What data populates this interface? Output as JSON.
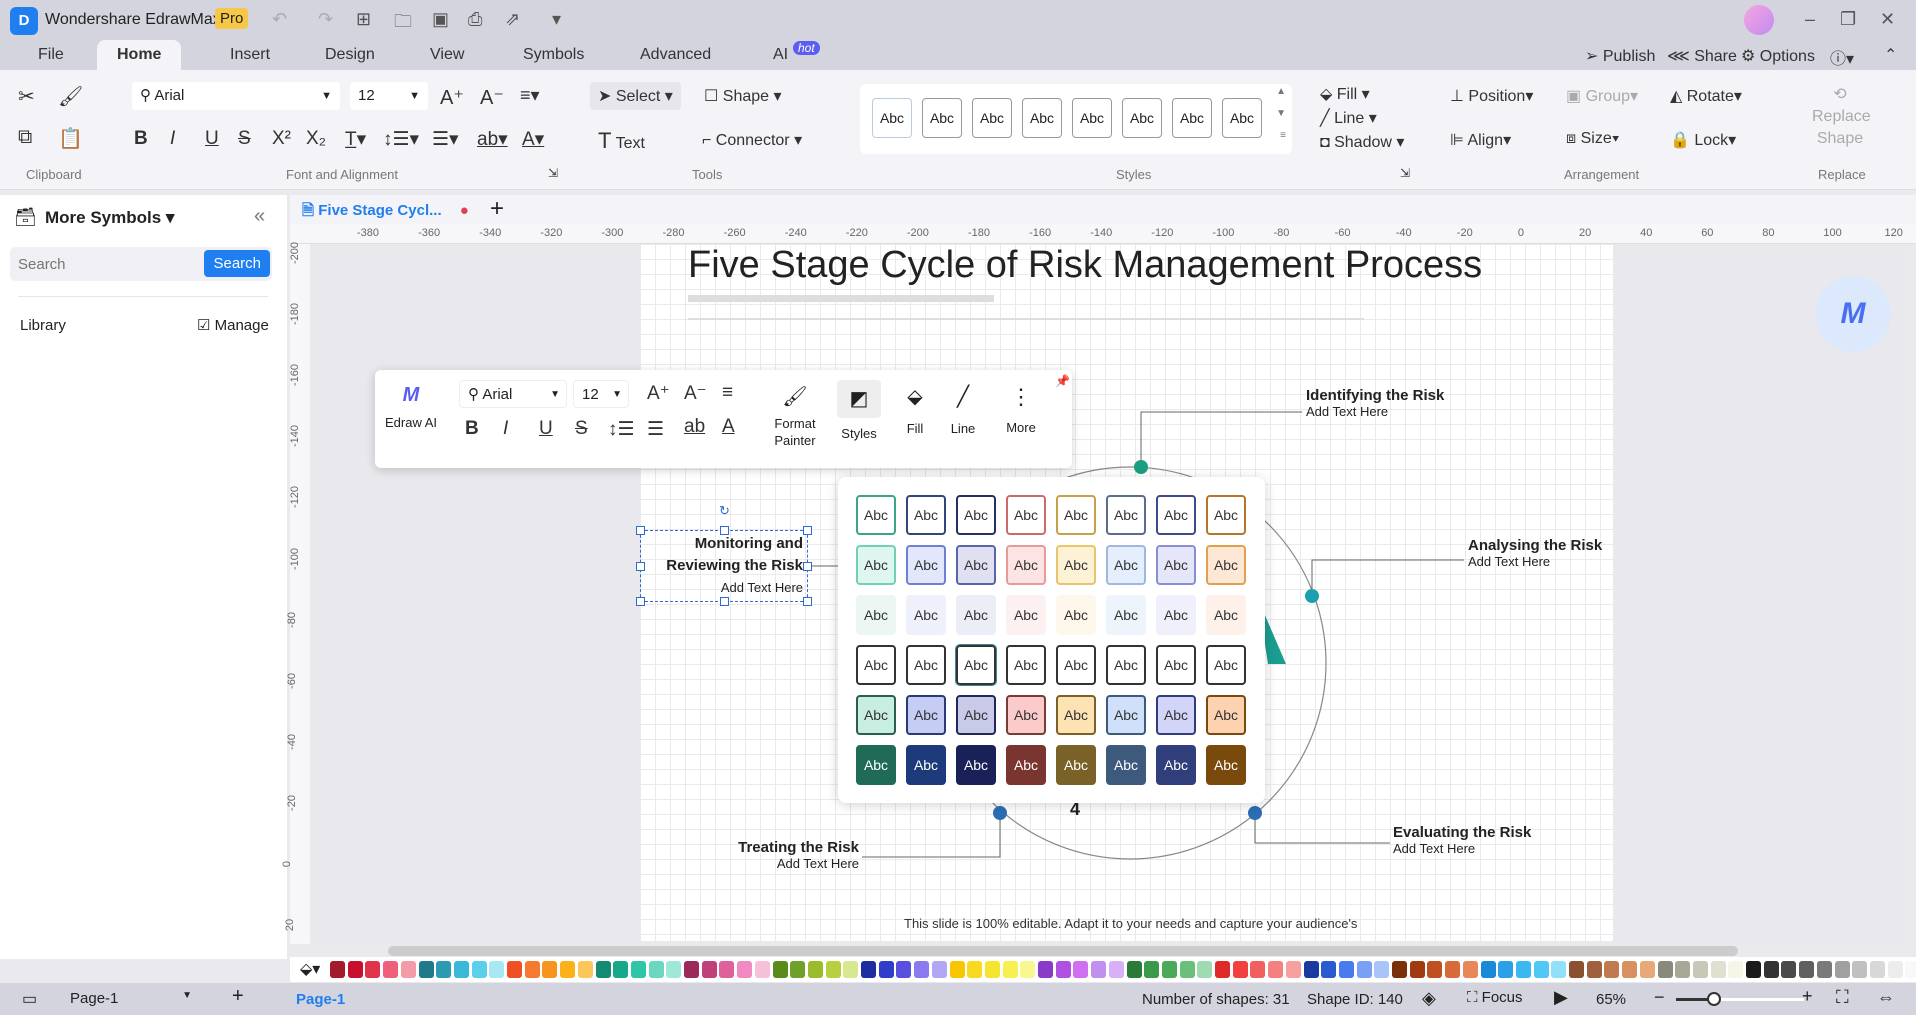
{
  "app": {
    "title": "Wondershare EdrawMax",
    "badge": "Pro"
  },
  "menu_tabs": [
    "File",
    "Home",
    "Insert",
    "Design",
    "View",
    "Symbols",
    "Advanced",
    "AI"
  ],
  "ai_badge": "hot",
  "top_right": {
    "publish": "Publish",
    "share": "Share",
    "options": "Options"
  },
  "ribbon": {
    "font": "Arial",
    "size": "12",
    "select": "Select",
    "shape": "Shape",
    "text": "Text",
    "connector": "Connector",
    "style_sample": "Abc",
    "fill": "Fill",
    "line": "Line",
    "shadow": "Shadow",
    "position": "Position",
    "group": "Group",
    "rotate": "Rotate",
    "align": "Align",
    "size_btn": "Size",
    "lock": "Lock",
    "replace_shape": "Replace Shape",
    "groups": {
      "clipboard": "Clipboard",
      "font": "Font and Alignment",
      "tools": "Tools",
      "styles": "Styles",
      "arrangement": "Arrangement",
      "replace": "Replace"
    }
  },
  "sidebar": {
    "title": "More Symbols",
    "search_placeholder": "Search",
    "search_button": "Search",
    "library": "Library",
    "manage": "Manage"
  },
  "doc_tab": {
    "title": "Five Stage Cycl..."
  },
  "ruler": {
    "h": [
      "-380",
      "-360",
      "-340",
      "-320",
      "-300",
      "-280",
      "-260",
      "-240",
      "-220",
      "-200",
      "-180",
      "-160",
      "-140",
      "-120",
      "-100",
      "-80",
      "-60",
      "-40",
      "-20",
      "0",
      "20",
      "40",
      "60",
      "80",
      "100",
      "120"
    ],
    "v": [
      "-200",
      "-180",
      "-160",
      "-140",
      "-120",
      "-100",
      "-80",
      "-60",
      "-40",
      "-20",
      "0",
      "20"
    ]
  },
  "diagram": {
    "title": "Five Stage Cycle of Risk Management Process",
    "stages": [
      {
        "title": "Identifying the Risk",
        "sub": "Add Text Here"
      },
      {
        "title": "Analysing the Risk",
        "sub": "Add Text Here"
      },
      {
        "title": "Evaluating the Risk",
        "sub": "Add Text Here"
      },
      {
        "title": "Treating the Risk",
        "sub": "Add Text Here"
      },
      {
        "title": "Monitoring and Reviewing the Risk",
        "sub": "Add Text Here"
      }
    ],
    "number": "4",
    "footer": "This slide is 100% editable. Adapt it to your needs and capture your audience's",
    "accent": "#1a9e8f"
  },
  "float_toolbar": {
    "edraw_ai": "Edraw AI",
    "font": "Arial",
    "size": "12",
    "format_painter": "Format Painter",
    "styles": "Styles",
    "fill": "Fill",
    "line": "Line",
    "more": "More"
  },
  "style_grid": {
    "label": "Abc",
    "rows": [
      {
        "fill": [
          "#ffffff",
          "#ffffff",
          "#ffffff",
          "#ffffff",
          "#ffffff",
          "#ffffff",
          "#ffffff",
          "#ffffff"
        ],
        "border": [
          "#3aa58a",
          "#33457a",
          "#262e63",
          "#c96b6b",
          "#c7a04a",
          "#5a6e8c",
          "#3f4a8a",
          "#b5762a"
        ],
        "text": "#333"
      },
      {
        "fill": [
          "#dff5ef",
          "#e2e7fb",
          "#dfe1f3",
          "#fde4e4",
          "#fdf1d6",
          "#e4eefc",
          "#e6e6fb",
          "#fde8d6"
        ],
        "border": [
          "#6fd0b8",
          "#6e82d4",
          "#5a64a8",
          "#e89a9a",
          "#e8c46a",
          "#a0b8e0",
          "#8890d4",
          "#e0a050"
        ],
        "text": "#333"
      },
      {
        "fill": [
          "#ecf7f3",
          "#eef0fb",
          "#eceef7",
          "#fdf0f0",
          "#fdf7ec",
          "#eef4fc",
          "#f0f0fc",
          "#fdf1ea"
        ],
        "border": [
          "#ecf7f3",
          "#eef0fb",
          "#eceef7",
          "#fdf0f0",
          "#fdf7ec",
          "#eef4fc",
          "#f0f0fc",
          "#fdf1ea"
        ],
        "text": "#333"
      },
      {
        "fill": [
          "#ffffff",
          "#ffffff",
          "#ffffff",
          "#ffffff",
          "#ffffff",
          "#ffffff",
          "#ffffff",
          "#ffffff"
        ],
        "border": [
          "#333",
          "#333",
          "#333",
          "#333",
          "#333",
          "#333",
          "#333",
          "#333"
        ],
        "text": "#333"
      },
      {
        "fill": [
          "#c8eee2",
          "#c5cdf5",
          "#c8cae8",
          "#fbcaca",
          "#fde2b4",
          "#d0e0fa",
          "#d2d4f8",
          "#fcd2b0"
        ],
        "border": [
          "#2a5f50",
          "#2a3a78",
          "#23285a",
          "#7a3a35",
          "#7a6128",
          "#3d5a7d",
          "#313e7c",
          "#7a4a0c"
        ],
        "text": "#333"
      },
      {
        "fill": [
          "#1f6b58",
          "#1d3b7a",
          "#1a2158",
          "#7a3530",
          "#7a6128",
          "#3d5a7d",
          "#313e7c",
          "#7a4a0c"
        ],
        "border": [
          "#1f6b58",
          "#1d3b7a",
          "#1a2158",
          "#7a3530",
          "#7a6128",
          "#3d5a7d",
          "#313e7c",
          "#7a4a0c"
        ],
        "text": "#fff"
      }
    ]
  },
  "palette": [
    "#a31a2a",
    "#c8102e",
    "#e0334a",
    "#f0607a",
    "#f59aa8",
    "#1f7a8c",
    "#2a9bb0",
    "#3ab8d8",
    "#5ad0ea",
    "#a8e8f5",
    "#f04e23",
    "#f57a30",
    "#f7941d",
    "#fbb21a",
    "#fcc65a",
    "#138a72",
    "#17a88a",
    "#2dc6a6",
    "#6ad8c0",
    "#9ee8d8",
    "#9b2a5a",
    "#c0407a",
    "#e0609a",
    "#f08ac0",
    "#f5c0d8",
    "#5a8a1a",
    "#6ea02a",
    "#9abb2a",
    "#b8d040",
    "#d8e890",
    "#1e2ea0",
    "#2e3ec8",
    "#5a50e0",
    "#8a7af0",
    "#b0a8f5",
    "#f7c600",
    "#f9d820",
    "#f5e430",
    "#f8f050",
    "#f8f890",
    "#8a3ac8",
    "#b050e0",
    "#d070f0",
    "#c090f0",
    "#d8b0f5",
    "#2a7a3a",
    "#3a9a4a",
    "#4aaa5a",
    "#6ac07a",
    "#a0dab0",
    "#e02a2a",
    "#f04040",
    "#f06060",
    "#f58080",
    "#f8a0a0",
    "#1a3aa0",
    "#2a5ad0",
    "#4a7af0",
    "#7aa0f5",
    "#a8c4f8",
    "#7a3008",
    "#a03a10",
    "#c05020",
    "#d86a3a",
    "#e8885a",
    "#1a8ad8",
    "#2aa0e8",
    "#3ab8f0",
    "#50c8f5",
    "#90e0fa",
    "#8a5030",
    "#a06040",
    "#c07a50",
    "#d89060",
    "#e8a878",
    "#8a8a7a",
    "#a8a898",
    "#c8c8b8",
    "#e0e0d0",
    "#f5f5e8",
    "#1a1a1a",
    "#333333",
    "#4a4a4a",
    "#606060",
    "#7a7a7a",
    "#a0a0a0",
    "#c0c0c0",
    "#d8d8d8",
    "#ececec",
    "#f8f8f8"
  ],
  "status": {
    "page_select": "Page-1",
    "page_tab": "Page-1",
    "shapes": "Number of shapes: 31",
    "shape_id": "Shape ID: 140",
    "focus": "Focus",
    "zoom": "65%",
    "zoom_level": 0.3
  }
}
